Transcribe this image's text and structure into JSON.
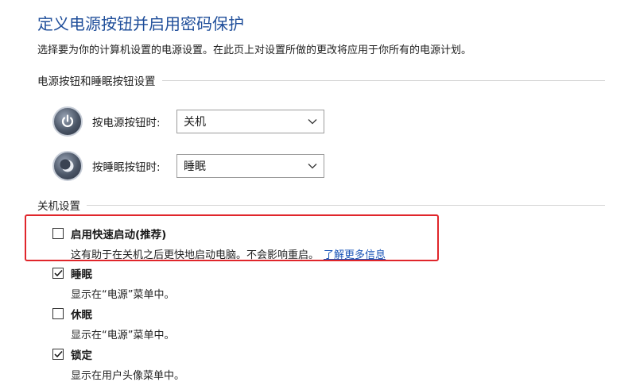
{
  "header": {
    "title": "定义电源按钮并启用密码保护",
    "description": "选择要为你的计算机设置的电源设置。在此页上对设置所做的更改将应用于你所有的电源计划。"
  },
  "power_section": {
    "heading": "电源按钮和睡眠按钮设置",
    "power_button": {
      "label": "按电源按钮时:",
      "value": "关机",
      "icon": "power-icon"
    },
    "sleep_button": {
      "label": "按睡眠按钮时:",
      "value": "睡眠",
      "icon": "sleep-moon-icon"
    }
  },
  "shutdown_section": {
    "heading": "关机设置",
    "options": [
      {
        "name": "启用快速启动(推荐)",
        "checked": false,
        "description": "这有助于在关机之后更快地启动电脑。不会影响重启。",
        "link": "了解更多信息"
      },
      {
        "name": "睡眠",
        "checked": true,
        "description": "显示在“电源”菜单中。"
      },
      {
        "name": "休眠",
        "checked": false,
        "description": "显示在“电源”菜单中。"
      },
      {
        "name": "锁定",
        "checked": true,
        "description": "显示在用户头像菜单中。"
      }
    ]
  },
  "colors": {
    "title": "#1f4e9a",
    "link": "#1a55b8",
    "highlight": "#e0262b"
  }
}
